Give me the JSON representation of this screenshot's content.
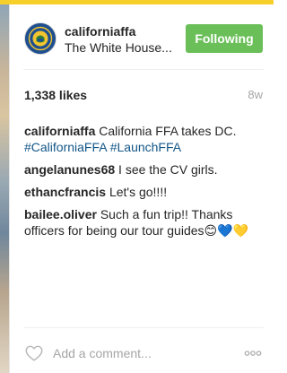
{
  "post": {
    "username": "californiaffa",
    "location": "The White House...",
    "follow_label": "Following",
    "likes": "1,338 likes",
    "age": "8w"
  },
  "comments": [
    {
      "user": "californiaffa",
      "text": "California FFA takes DC.",
      "hashtags": "#CaliforniaFFA #LaunchFFA"
    },
    {
      "user": "angelanunes68",
      "text": "I see the CV girls."
    },
    {
      "user": "ethancfrancis",
      "text": "Let's go!!!!"
    },
    {
      "user": "bailee.oliver",
      "text": "Such a fun trip!! Thanks officers for being our tour guides",
      "emoji": [
        "😊",
        "💙",
        "💛"
      ]
    }
  ],
  "footer": {
    "comment_placeholder": "Add a comment...",
    "heart_icon": "heart-outline-icon",
    "more_icon": "more-options-icon"
  },
  "colors": {
    "follow_button": "#6abf58",
    "hashtag": "#125688",
    "top_stripe": "#f6cf2a",
    "muted_text": "#a5a5a5"
  }
}
